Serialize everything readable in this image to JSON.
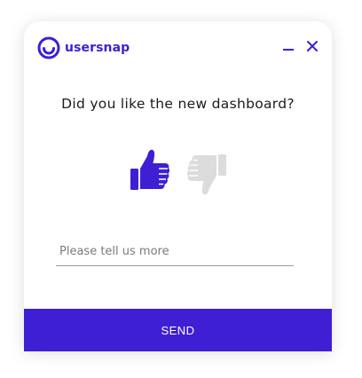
{
  "brand": {
    "name": "usersnap",
    "color": "#3f1fd4",
    "logo_icon": "usersnap-smile-logo-icon"
  },
  "window_controls": {
    "minimize_icon": "minimize-icon",
    "close_icon": "close-icon"
  },
  "survey": {
    "question": "Did you like the new dashboard?",
    "thumbs_up_icon": "thumbs-up-icon",
    "thumbs_up_state": "selected",
    "thumbs_up_color": "#3f1fd4",
    "thumbs_down_icon": "thumbs-down-icon",
    "thumbs_down_state": "unselected",
    "thumbs_down_color": "#dcdcdc"
  },
  "comment": {
    "placeholder": "Please tell us more",
    "value": ""
  },
  "actions": {
    "send_label": "SEND"
  }
}
